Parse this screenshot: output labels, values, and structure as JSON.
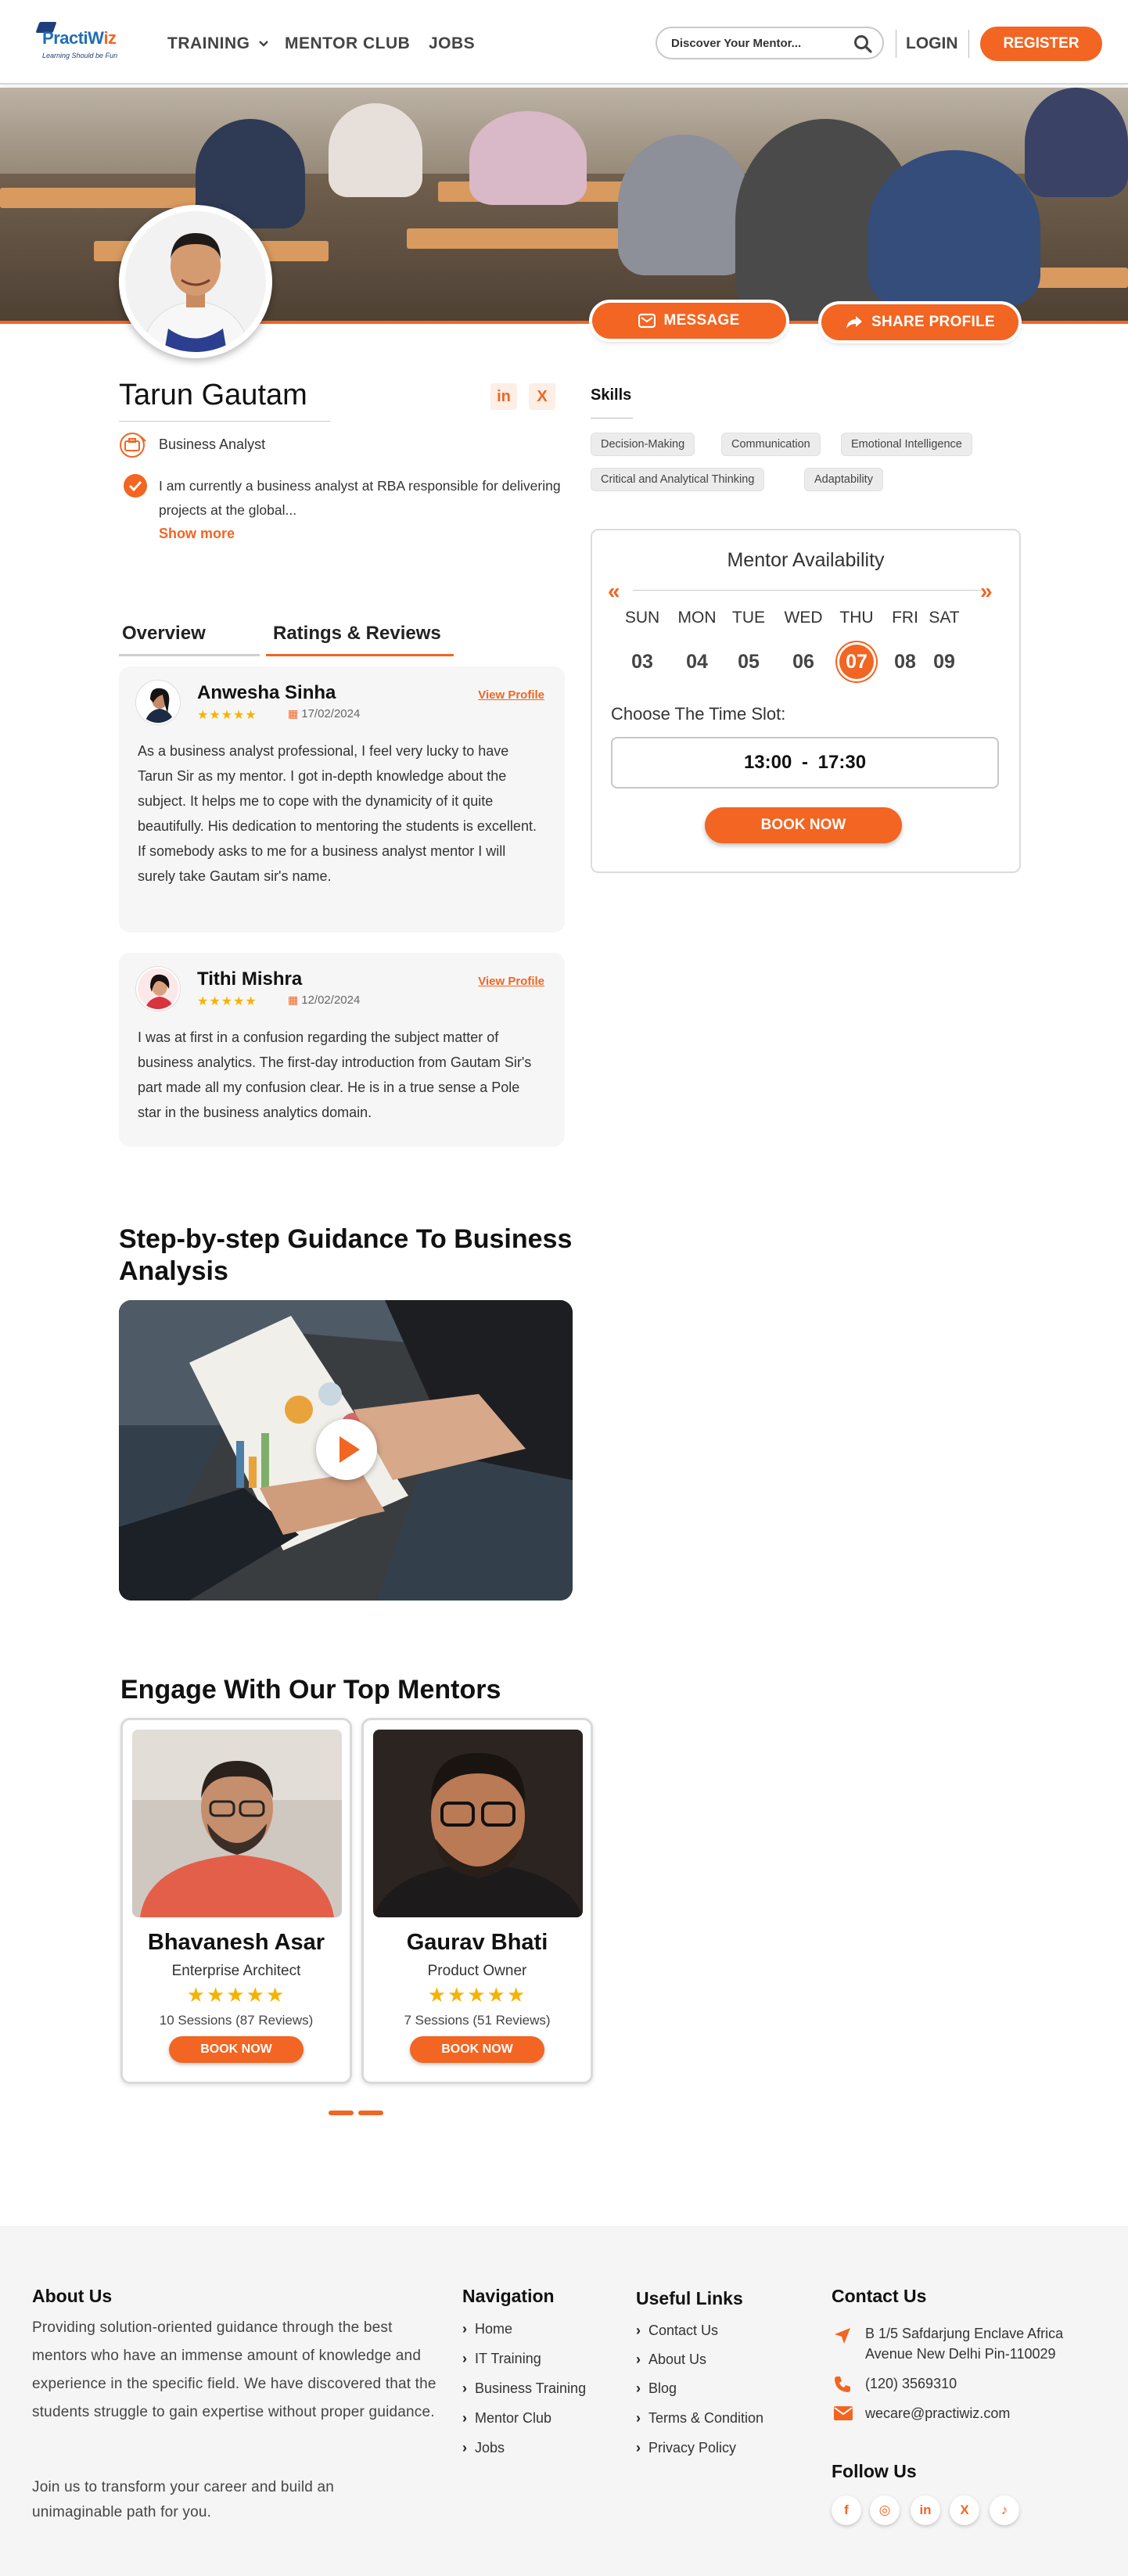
{
  "header": {
    "logo_brand_prefix": "P",
    "logo_brand_main": "ractiW",
    "logo_brand_suffix": "iz",
    "logo_tagline": "Learning Should be Fun",
    "nav": [
      "TRAINING",
      "MENTOR CLUB",
      "JOBS"
    ],
    "search_placeholder": "Discover Your Mentor...",
    "login": "LOGIN",
    "register": "REGISTER"
  },
  "hero": {
    "message_btn": "MESSAGE",
    "share_btn": "SHARE PROFILE"
  },
  "profile": {
    "name": "Tarun Gautam",
    "social": [
      "in",
      "X"
    ],
    "role": "Business Analyst",
    "bio": "I am currently a business analyst at RBA responsible for delivering projects at the global...",
    "show_more": "Show more"
  },
  "skills": {
    "title": "Skills",
    "items": [
      "Decision-Making",
      "Communication",
      "Emotional Intelligence",
      "Critical and Analytical Thinking",
      "Adaptability"
    ]
  },
  "availability": {
    "title": "Mentor Availability",
    "prev": "«",
    "next": "»",
    "days": [
      "SUN",
      "MON",
      "TUE",
      "WED",
      "THU",
      "FRI",
      "SAT"
    ],
    "dates": [
      "03",
      "04",
      "05",
      "06",
      "07",
      "08",
      "09"
    ],
    "selected_index": 4,
    "slot_label": "Choose The Time Slot:",
    "slot_value": "13:00 - 17:30",
    "book": "BOOK NOW"
  },
  "tabs": [
    "Overview",
    "Ratings & Reviews"
  ],
  "active_tab": 1,
  "reviews": [
    {
      "name": "Anwesha Sinha",
      "stars": "★★★★★",
      "date": "17/02/2024",
      "link": "View Profile",
      "text": "As a business analyst professional, I feel very lucky to have Tarun Sir as my mentor. I got in-depth knowledge about the subject. It helps me to cope with the dynamicity of it quite beautifully. His dedication to mentoring the students is excellent. If somebody asks to me for a business analyst mentor I will surely take Gautam sir's name."
    },
    {
      "name": "Tithi Mishra",
      "stars": "★★★★★",
      "date": "12/02/2024",
      "link": "View Profile",
      "text": "I was at first in a confusion regarding the subject matter of business analytics. The first-day introduction from Gautam Sir's part made all my confusion clear. He is in a true sense a Pole star in the business analytics domain."
    }
  ],
  "video_section": {
    "title": "Step-by-step Guidance To Business Analysis"
  },
  "mentors_section": {
    "title": "Engage With Our Top Mentors",
    "mentors": [
      {
        "name": "Bhavanesh Asar",
        "role": "Enterprise Architect",
        "stars": "★★★★★",
        "sessions": "10 Sessions (87 Reviews)",
        "book": "BOOK NOW"
      },
      {
        "name": "Gaurav Bhati",
        "role": "Product Owner",
        "stars": "★★★★★",
        "sessions": "7 Sessions (51 Reviews)",
        "book": "BOOK NOW"
      }
    ]
  },
  "footer": {
    "about_title": "About Us",
    "about_text": "Providing solution-oriented guidance through the best mentors who have an immense amount of knowledge and experience in the specific field. We have discovered that the students struggle to gain expertise without proper guidance.",
    "about_text2": "Join us to transform your career and build an unimaginable path for you.",
    "nav_title": "Navigation",
    "nav_links": [
      "Home",
      "IT Training",
      "Business Training",
      "Mentor Club",
      "Jobs"
    ],
    "useful_title": "Useful Links",
    "useful_links": [
      "Contact Us",
      "About Us",
      "Blog",
      "Terms & Condition",
      "Privacy Policy"
    ],
    "contact_title": "Contact Us",
    "address": "B 1/5 Safdarjung Enclave Africa Avenue New Delhi Pin-110029",
    "phone": "(120) 3569310",
    "email": "wecare@practiwiz.com",
    "follow_title": "Follow Us",
    "follow_icons": [
      "f",
      "◎",
      "in",
      "X",
      "♪"
    ]
  },
  "colors": {
    "accent": "#f26522",
    "star": "#f5b301",
    "brand_blue": "#1f6fb5"
  }
}
